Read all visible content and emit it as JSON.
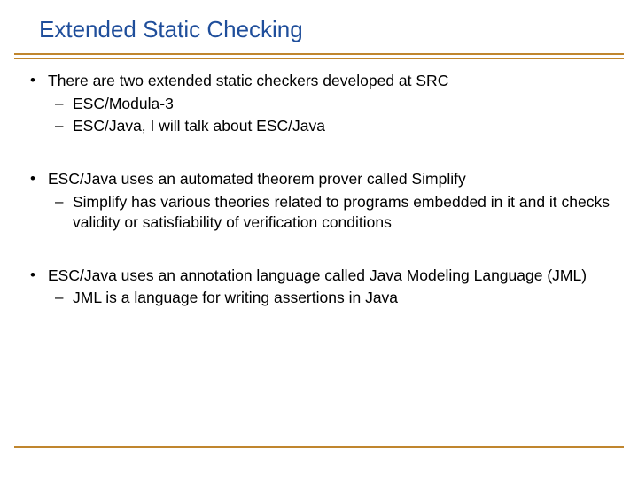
{
  "title": "Extended Static Checking",
  "bullets": [
    {
      "text": "There are two extended static checkers developed at SRC",
      "subs": [
        "ESC/Modula-3",
        "ESC/Java, I will talk about ESC/Java"
      ]
    },
    {
      "text": "ESC/Java uses an automated theorem prover called Simplify",
      "subs": [
        "Simplify has various theories related to programs embedded in it and it checks validity or satisfiability of verification conditions"
      ]
    },
    {
      "text": "ESC/Java uses an annotation language called Java Modeling Language (JML)",
      "subs": [
        "JML is a language for writing assertions in Java"
      ]
    }
  ]
}
